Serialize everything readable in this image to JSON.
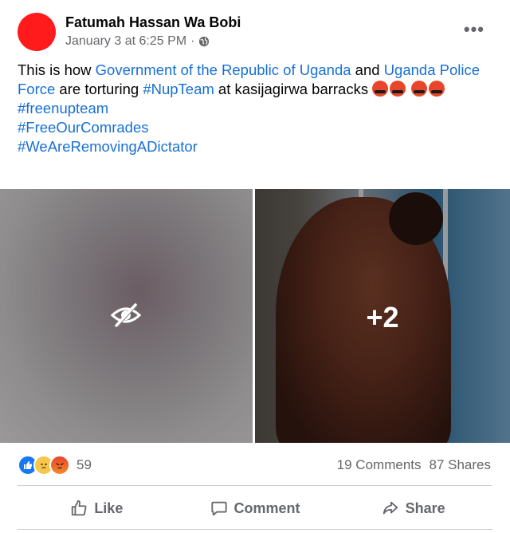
{
  "post": {
    "author": "Fatumah Hassan Wa Bobi",
    "timestamp": "January 3 at 6:25 PM",
    "separator": "·",
    "audience_icon": "globe-icon",
    "more_icon": "•••",
    "text_segments": [
      {
        "type": "text",
        "value": "This is how "
      },
      {
        "type": "link",
        "value": "Government of the Republic of Uganda"
      },
      {
        "type": "text",
        "value": "  and "
      },
      {
        "type": "link",
        "value": "Uganda Police Force"
      },
      {
        "type": "text",
        "value": "  are torturing "
      },
      {
        "type": "link",
        "value": "#NupTeam"
      },
      {
        "type": "text",
        "value": " at kasijagirwa barracks"
      }
    ],
    "hashtags": [
      "#freenupteam",
      "#FreeOurComrades",
      "#WeAreRemovingADictator"
    ],
    "media": {
      "hidden_icon": "eye-slash-icon",
      "more_count": "+2"
    },
    "reactions": {
      "icons": [
        "like-reaction-icon",
        "sad-reaction-icon",
        "angry-reaction-icon"
      ],
      "count": "59"
    },
    "comments": "19 Comments",
    "shares": "87 Shares",
    "actions": [
      {
        "label": "Like",
        "icon": "thumbs-up-icon"
      },
      {
        "label": "Comment",
        "icon": "comment-bubble-icon"
      },
      {
        "label": "Share",
        "icon": "share-arrow-icon"
      }
    ],
    "colors": {
      "link": "#1870d5",
      "avatar": "#ff1b1b",
      "muted": "#65676b"
    }
  }
}
